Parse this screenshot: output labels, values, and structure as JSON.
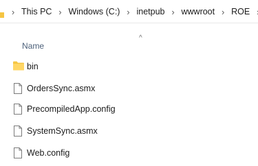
{
  "breadcrumb": {
    "items": [
      "This PC",
      "Windows (C:)",
      "inetpub",
      "wwwroot",
      "ROE"
    ],
    "separator": "›"
  },
  "columns": {
    "name_label": "Name",
    "sort_indicator": "^"
  },
  "files": [
    {
      "name": "bin",
      "icon": "folder-icon"
    },
    {
      "name": "OrdersSync.asmx",
      "icon": "document-icon"
    },
    {
      "name": "PrecompiledApp.config",
      "icon": "document-icon"
    },
    {
      "name": "SystemSync.asmx",
      "icon": "document-icon"
    },
    {
      "name": "Web.config",
      "icon": "document-icon"
    }
  ],
  "colors": {
    "folder": "#f5c542",
    "header_text": "#4c607a"
  }
}
